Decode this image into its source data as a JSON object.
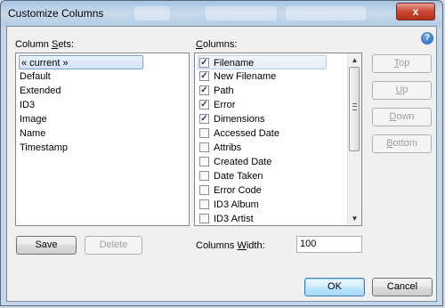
{
  "window": {
    "title": "Customize Columns",
    "close_label": "x",
    "help_label": "?"
  },
  "column_sets": {
    "label_prefix": "Column ",
    "label_accel": "S",
    "label_suffix": "ets:",
    "items": [
      "« current »",
      "Default",
      "Extended",
      "ID3",
      "Image",
      "Name",
      "Timestamp"
    ],
    "selected_index": 0
  },
  "columns": {
    "label_accel": "C",
    "label_suffix": "olumns:",
    "items": [
      {
        "label": "Filename",
        "checked": true
      },
      {
        "label": "New Filename",
        "checked": true
      },
      {
        "label": "Path",
        "checked": true
      },
      {
        "label": "Error",
        "checked": true
      },
      {
        "label": "Dimensions",
        "checked": true
      },
      {
        "label": "Accessed Date",
        "checked": false
      },
      {
        "label": "Attribs",
        "checked": false
      },
      {
        "label": "Created Date",
        "checked": false
      },
      {
        "label": "Date Taken",
        "checked": false
      },
      {
        "label": "Error Code",
        "checked": false
      },
      {
        "label": "ID3 Album",
        "checked": false
      },
      {
        "label": "ID3 Artist",
        "checked": false
      }
    ],
    "check_mark": "✓"
  },
  "move_buttons": {
    "top": {
      "accel": "T",
      "rest": "op"
    },
    "up": {
      "accel": "U",
      "rest": "p"
    },
    "down": {
      "accel": "D",
      "rest": "own"
    },
    "bottom": {
      "accel": "B",
      "rest": "ottom"
    }
  },
  "save_label": "Save",
  "delete_label": "Delete",
  "columns_width": {
    "label_prefix": "Columns ",
    "label_accel": "W",
    "label_suffix": "idth:",
    "value": "100"
  },
  "ok_label": "OK",
  "cancel_label": "Cancel",
  "scroll": {
    "up_arrow": "▲",
    "down_arrow": "▼"
  }
}
